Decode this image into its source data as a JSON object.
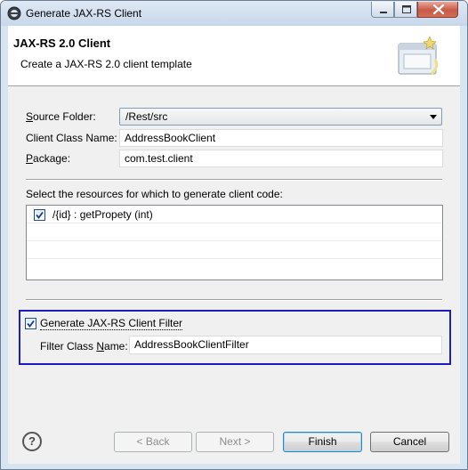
{
  "window": {
    "title": "Generate JAX-RS Client"
  },
  "banner": {
    "title": "JAX-RS 2.0 Client",
    "description": "Create a JAX-RS 2.0 client template"
  },
  "form": {
    "source_folder_label_u": "S",
    "source_folder_label_rest": "ource Folder:",
    "source_folder_value": "/Rest/src",
    "client_class_label": "Client Class Name:",
    "client_class_value": "AddressBookClient",
    "package_label_u": "P",
    "package_label_rest": "ackage:",
    "package_value": "com.test.client"
  },
  "resources": {
    "heading": "Select the resources for which to generate client code:",
    "items": [
      {
        "label": "/{id} : getPropety (int)",
        "checked": true
      }
    ]
  },
  "filter": {
    "checkbox_label": "Generate JAX-RS Client Filter",
    "checked": true,
    "class_label_pre": "Filter Class ",
    "class_label_u": "N",
    "class_label_post": "ame:",
    "class_value": "AddressBookClientFilter"
  },
  "buttons": {
    "help": "?",
    "back": "< Back",
    "back_u": "B",
    "next": "Next >",
    "next_u": "N",
    "finish": "Finish",
    "cancel": "Cancel"
  },
  "colors": {
    "highlight_border": "#1c1cc0",
    "title_bar": "#c7d7ea",
    "close_button": "#c75a45"
  }
}
